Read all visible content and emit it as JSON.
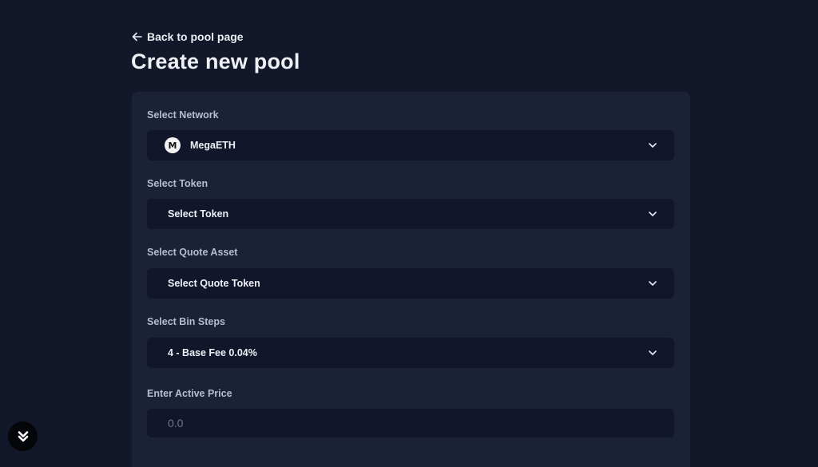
{
  "nav": {
    "back_label": "Back to pool page"
  },
  "page": {
    "title": "Create new pool"
  },
  "form": {
    "network": {
      "label": "Select Network",
      "value": "MegaETH",
      "logo_letter": "M"
    },
    "token": {
      "label": "Select Token",
      "value": "Select Token"
    },
    "quote_asset": {
      "label": "Select Quote Asset",
      "value": "Select Quote Token"
    },
    "bin_steps": {
      "label": "Select Bin Steps",
      "value": "4 - Base Fee 0.04%"
    },
    "active_price": {
      "label": "Enter Active Price",
      "placeholder": "0.0"
    }
  },
  "icons": {
    "back": "arrow-left-icon",
    "dropdown": "chevron-down-icon",
    "float": "double-chevron-down-icon"
  },
  "colors": {
    "background": "#121729",
    "card": "#1b2136",
    "field": "#11162a"
  }
}
